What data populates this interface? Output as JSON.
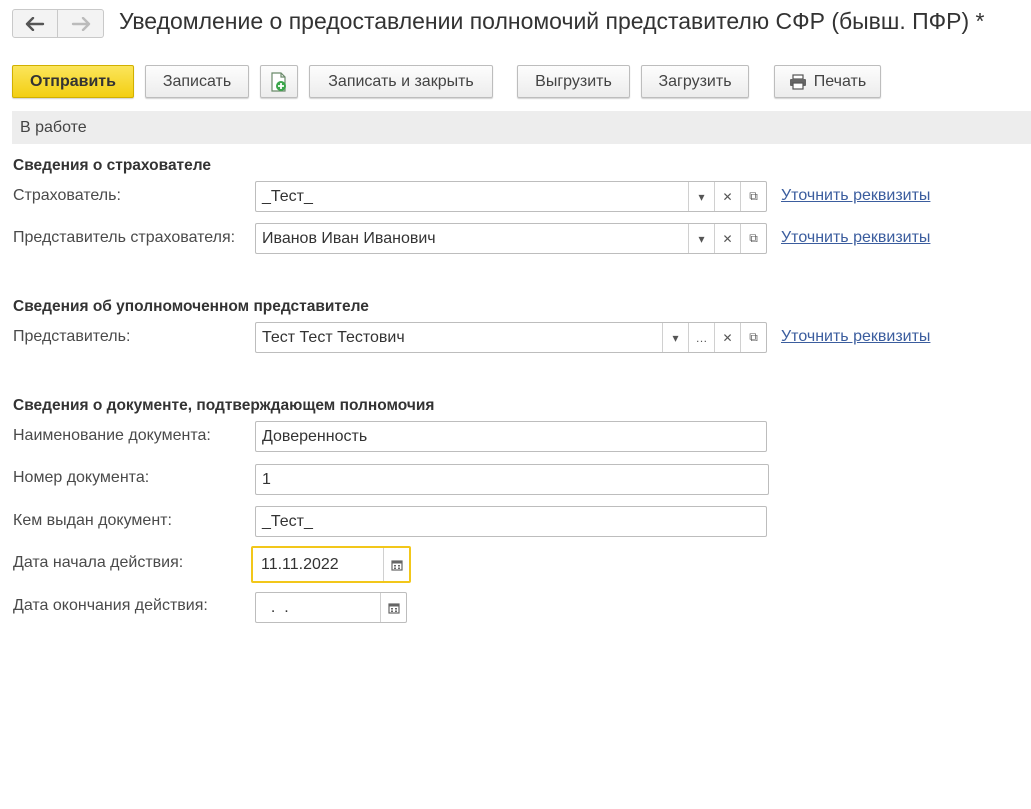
{
  "header": {
    "title": "Уведомление о предоставлении полномочий представителю СФР (бывш. ПФР) *"
  },
  "toolbar": {
    "send": "Отправить",
    "save": "Записать",
    "save_close": "Записать и закрыть",
    "export": "Выгрузить",
    "import": "Загрузить",
    "print": "Печать"
  },
  "status": "В работе",
  "sections": {
    "insurer": {
      "title": "Сведения о страхователе",
      "insurer_label": "Страхователь:",
      "insurer_value": "_Тест_",
      "rep_label": "Представитель страхователя:",
      "rep_value": "Иванов Иван Иванович",
      "clarify_link": "Уточнить реквизиты"
    },
    "authorized": {
      "title": "Сведения об уполномоченном представителе",
      "rep_label": "Представитель:",
      "rep_value": "Тест Тест Тестович",
      "clarify_link": "Уточнить реквизиты"
    },
    "document": {
      "title": "Сведения о документе, подтверждающем полномочия",
      "name_label": "Наименование документа:",
      "name_value": "Доверенность",
      "number_label": "Номер документа:",
      "number_value": "1",
      "issuer_label": "Кем выдан документ:",
      "issuer_value": "_Тест_",
      "start_label": "Дата начала действия:",
      "start_value": "11.11.2022",
      "end_label": "Дата окончания действия:",
      "end_value": "  .  ."
    }
  },
  "colors": {
    "accent": "#f3cf12",
    "link": "#3b5d9e",
    "status_bg": "#ededed",
    "focus_border": "#f2c71a"
  },
  "icons": {
    "back": "arrow-left-icon",
    "forward": "arrow-right-icon",
    "new_doc": "add-document-icon",
    "print": "printer-icon",
    "dropdown": "chevron-down-icon",
    "more": "ellipsis-icon",
    "clear": "close-icon",
    "open": "open-window-icon",
    "calendar": "calendar-icon"
  }
}
